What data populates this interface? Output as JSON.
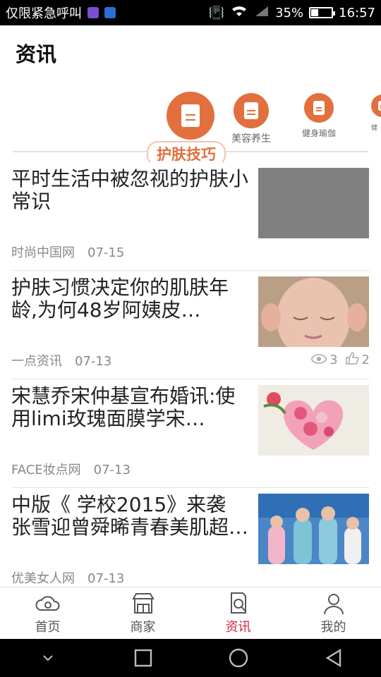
{
  "status_bar": {
    "carrier_text": "仅限紧急呼叫",
    "battery_percent": "35%",
    "battery_level": 0.35,
    "time": "16:57"
  },
  "header": {
    "title": "资讯"
  },
  "categories": {
    "active": "护肤技巧",
    "items": [
      {
        "label": "美容养生"
      },
      {
        "label": "健身瑜伽"
      },
      {
        "label": "健"
      }
    ]
  },
  "articles": [
    {
      "title": "平时生活中被忽视的护肤小常识",
      "source": "时尚中国网",
      "date": "07-15"
    },
    {
      "title": "护肤习惯决定你的肌肤年龄,为何48岁阿姨皮…",
      "source": "一点资讯",
      "date": "07-13",
      "views": "3",
      "likes": "2"
    },
    {
      "title": "宋慧乔宋仲基宣布婚讯:使用limi玫瑰面膜学宋…",
      "source": "FACE妆点网",
      "date": "07-13"
    },
    {
      "title": "中版《 学校2015》来袭 张雪迎曾舜晞青春美肌超…",
      "source": "优美女人网",
      "date": "07-13"
    }
  ],
  "bottom_nav": [
    {
      "label": "首页",
      "icon": "cloud-home-icon"
    },
    {
      "label": "商家",
      "icon": "storefront-icon"
    },
    {
      "label": "资讯",
      "icon": "news-search-icon",
      "active": true
    },
    {
      "label": "我的",
      "icon": "user-icon"
    }
  ],
  "colors": {
    "accent": "#e2703e",
    "nav_active": "#d1243f"
  }
}
